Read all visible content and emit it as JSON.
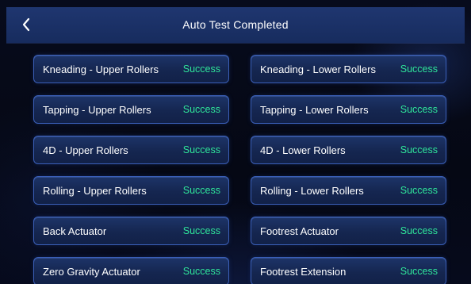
{
  "header": {
    "title": "Auto Test Completed",
    "back_icon": "chevron-left-icon"
  },
  "colors": {
    "header_bg": "#1b3166",
    "card_border": "#3a5fb8",
    "success": "#2fe49a"
  },
  "tests": [
    {
      "label": "Kneading - Upper Rollers",
      "status": "Success"
    },
    {
      "label": "Kneading - Lower Rollers",
      "status": "Success"
    },
    {
      "label": "Tapping - Upper Rollers",
      "status": "Success"
    },
    {
      "label": "Tapping - Lower Rollers",
      "status": "Success"
    },
    {
      "label": "4D - Upper Rollers",
      "status": "Success"
    },
    {
      "label": "4D - Lower Rollers",
      "status": "Success"
    },
    {
      "label": "Rolling - Upper Rollers",
      "status": "Success"
    },
    {
      "label": "Rolling - Lower Rollers",
      "status": "Success"
    },
    {
      "label": "Back Actuator",
      "status": "Success"
    },
    {
      "label": "Footrest Actuator",
      "status": "Success"
    },
    {
      "label": "Zero Gravity Actuator",
      "status": "Success"
    },
    {
      "label": "Footrest Extension",
      "status": "Success"
    }
  ]
}
